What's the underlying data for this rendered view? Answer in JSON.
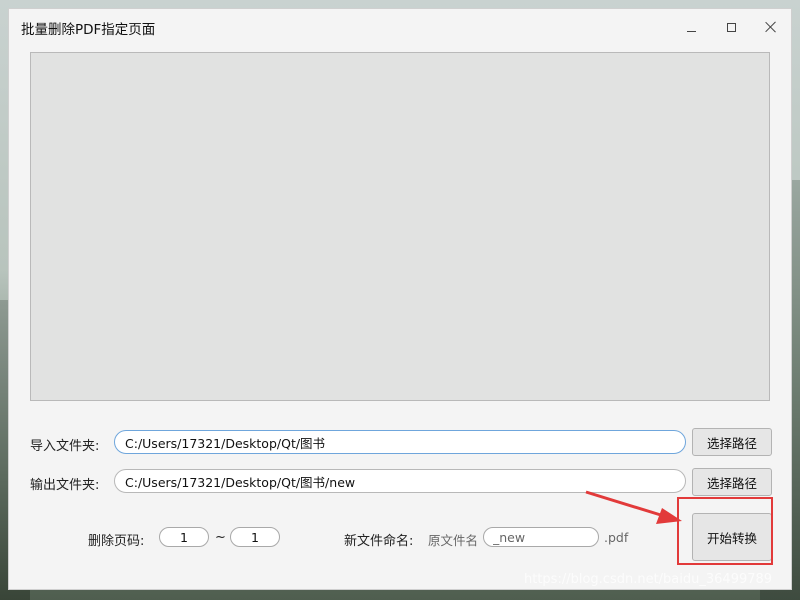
{
  "window": {
    "title": "批量删除PDF指定页面"
  },
  "import_folder": {
    "label": "导入文件夹:",
    "value": "C:/Users/17321/Desktop/Qt/图书",
    "button_label": "选择路径"
  },
  "export_folder": {
    "label": "输出文件夹:",
    "value": "C:/Users/17321/Desktop/Qt/图书/new",
    "button_label": "选择路径"
  },
  "delete_pages": {
    "label": "删除页码:",
    "from": "1",
    "separator": "~",
    "to": "1"
  },
  "rename": {
    "label": "新文件命名:",
    "prefix": "原文件名",
    "suffix_value": "_new",
    "extension": ".pdf"
  },
  "start_button_label": "开始转换",
  "watermark": "https://blog.csdn.net/baidu_36499789",
  "colors": {
    "highlight_red": "#e23a3a",
    "input_focus_blue": "#6fa6dc"
  }
}
